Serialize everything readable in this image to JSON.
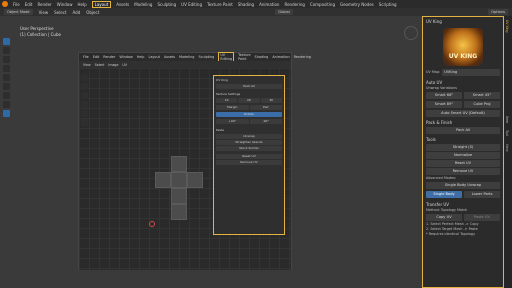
{
  "topbar": {
    "menus": [
      "File",
      "Edit",
      "Render",
      "Window",
      "Help"
    ],
    "workspaces": [
      "Layout",
      "Assets",
      "Modeling",
      "Sculpting",
      "UV Editing",
      "Texture Paint",
      "Shading",
      "Animation",
      "Rendering",
      "Compositing",
      "Geometry Nodes",
      "Scripting"
    ],
    "active_workspace": "Layout",
    "options_label": "Options"
  },
  "header": {
    "mode": "Object Mode",
    "view": "View",
    "select": "Select",
    "add": "Add",
    "object": "Object",
    "transform": "Global"
  },
  "viewport": {
    "perspective": "User Perspective",
    "collection": "(1) Collection | Cube"
  },
  "inner": {
    "menus": [
      "File",
      "Edit",
      "Render",
      "Window",
      "Help"
    ],
    "workspaces": [
      "Layout",
      "Assets",
      "Modeling",
      "Sculpting",
      "UV Editing",
      "Texture Paint",
      "Shading",
      "Animation",
      "Rendering"
    ],
    "active_workspace": "UV Editing",
    "header": [
      "View",
      "Select",
      "Image",
      "UV"
    ],
    "panel": {
      "title": "UV King",
      "pack_all": "Pack All",
      "texture_settings": "Texture Settings",
      "res_labels": [
        "1K",
        "2K",
        "4K"
      ],
      "margin": "Margin",
      "pad": "Pad",
      "rotate": "Rotate",
      "extra_rows": [
        "+90°",
        "-90°"
      ],
      "paste": "Paste",
      "unwrap": "Unwrap",
      "straighten_islands": "Straighten Islands",
      "stack_similar": "Stack Similar",
      "reset_uv": "Reset UV",
      "remove_uv": "Remove UV"
    }
  },
  "sidebar": {
    "title": "UV King",
    "logo_text": "UV KING",
    "uv_map_label": "UV Map:",
    "uv_map_value": "UVKing",
    "auto_uv": "Auto UV",
    "unwrap_variations": "Unwrap Variations",
    "variations": [
      "Smart 66°",
      "Smart 45°",
      "Smart 89°",
      "Cube Proj"
    ],
    "auto_smart": "Auto Smart UV (Default)",
    "pack_finish": "Pack & Finish",
    "pack_all": "Pack All",
    "tools": "Tools",
    "straighten": "Straight (S)",
    "normalize": "Normalize",
    "reset_uv": "Reset UV",
    "remove_uv": "Remove UV",
    "advanced_modes": "Advanced Modes:",
    "single_body_unwrap": "Single Body Unwrap",
    "single_body": "Single Body",
    "lower_parts": "Lower Parts",
    "transfer_uv": "Transfer UV",
    "method": "Method: Topology Match",
    "copy_uv": "Copy UV",
    "paste_uv": "Paste UV",
    "steps": [
      "1. Select Perfect Mesh -> Copy",
      "2. Select Target Mesh -> Paste",
      "* Requires identical Topology"
    ],
    "vtabs": [
      "Item",
      "Tool",
      "View",
      "UV King"
    ]
  },
  "colors": {
    "highlight": "#e3b341",
    "accent_blue": "#3f6ea6"
  }
}
